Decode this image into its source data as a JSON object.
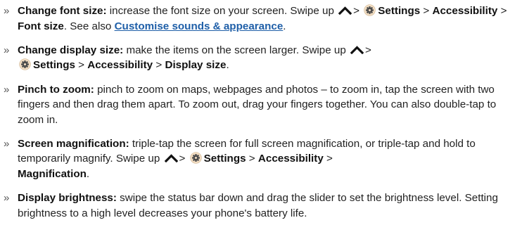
{
  "bullet_glyph": "»",
  "sep": ">",
  "items": [
    {
      "title": "Change font size:",
      "text1": " increase the font size on your screen. Swipe up ",
      "settings": "Settings",
      "accessibility": "Accessibility",
      "target": "Font size",
      "see_also": ". See also ",
      "link": "Customise sounds & appearance",
      "end": "."
    },
    {
      "title": "Change display size:",
      "text1": " make the items on the screen larger. Swipe up ",
      "settings": "Settings",
      "accessibility": "Accessibility",
      "target": "Display size",
      "end": "."
    },
    {
      "title": "Pinch to zoom:",
      "text1": " pinch to zoom on maps, webpages and photos – to zoom in, tap the screen with two fingers and then drag them apart. To zoom out, drag your fingers together. You can also double-tap to zoom in."
    },
    {
      "title": "Screen magnification:",
      "text1": " triple-tap the screen for full screen magnification, or triple-tap and hold to temporarily magnify. Swipe up ",
      "settings": "Settings",
      "accessibility": "Accessibility",
      "target": "Magnification",
      "end": "."
    },
    {
      "title": "Display brightness:",
      "text1": " swipe the status bar down and drag the slider to set the brightness level. Setting brightness to a high level decreases your phone's battery life."
    }
  ],
  "icons": {
    "swipe_up": "caret-up-icon",
    "settings": "settings-gear-icon"
  },
  "colors": {
    "link": "#1f5fa8",
    "text": "#222222"
  }
}
